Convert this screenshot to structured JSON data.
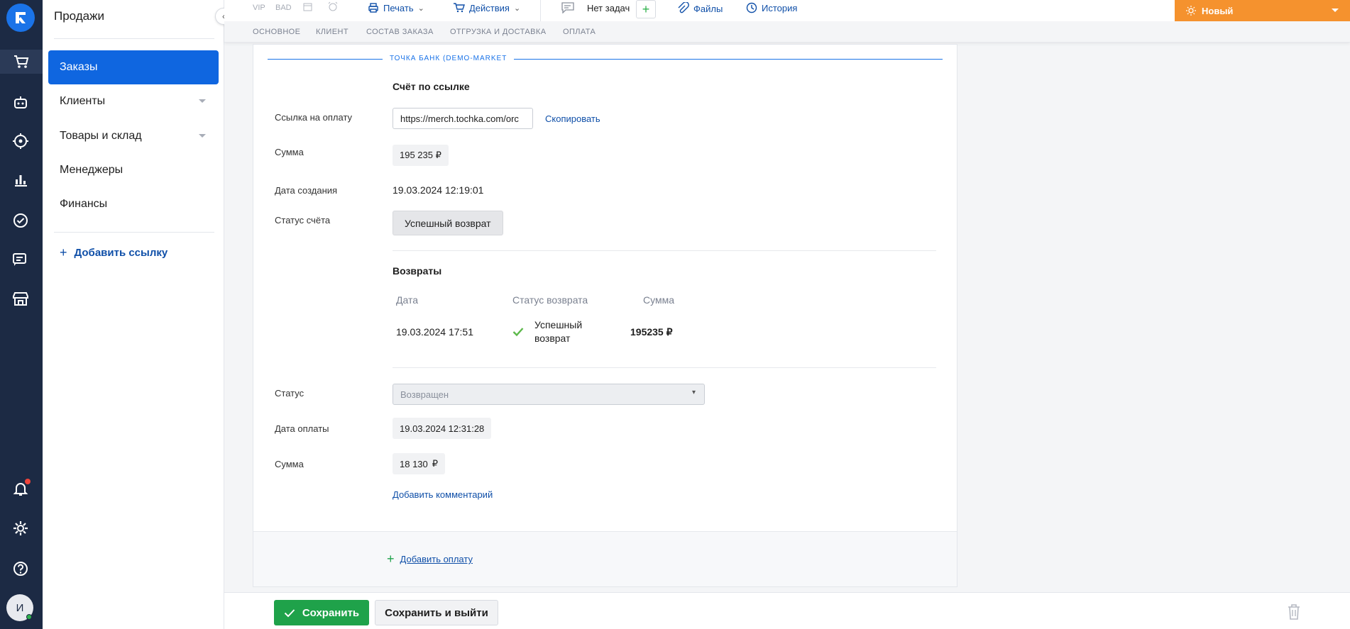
{
  "sidebar": {
    "title": "Продажи",
    "items": [
      {
        "label": "Заказы",
        "active": true
      },
      {
        "label": "Клиенты"
      },
      {
        "label": "Товары и склад"
      },
      {
        "label": "Менеджеры"
      },
      {
        "label": "Финансы"
      }
    ],
    "add_link": "Добавить ссылку"
  },
  "rail": {
    "avatar_initial": "И"
  },
  "topbar": {
    "vip": "VIP",
    "bad": "BAD",
    "print": "Печать",
    "actions": "Действия",
    "tasks": "Нет задач",
    "files": "Файлы",
    "history": "История",
    "status": "Новый",
    "status_color": "#f5922e"
  },
  "tabs": [
    "ОСНОВНОЕ",
    "КЛИЕНТ",
    "СОСТАВ ЗАКАЗА",
    "ОТГРУЗКА И ДОСТАВКА",
    "ОПЛАТА"
  ],
  "payment": {
    "bank": "ТОЧКА БАНК (DEMO-MARKET",
    "section_title": "Счёт по ссылке",
    "link_label": "Ссылка на оплату",
    "link_value": "https://merch.tochka.com/orc",
    "copy": "Скопировать",
    "sum_label": "Сумма",
    "sum_value": "195 235 ₽",
    "created_label": "Дата создания",
    "created_value": "19.03.2024 12:19:01",
    "invoice_status_label": "Статус счёта",
    "invoice_status_value": "Успешный возврат",
    "refunds": {
      "title": "Возвраты",
      "col_date": "Дата",
      "col_status": "Статус возврата",
      "col_sum": "Сумма",
      "rows": [
        {
          "date": "19.03.2024 17:51",
          "status_line1": "Успешный",
          "status_line2": "возврат",
          "sum": "195235 ₽"
        }
      ]
    },
    "status_label": "Статус",
    "status_value": "Возвращен",
    "paid_date_label": "Дата оплаты",
    "paid_date_value": "19.03.2024 12:31:28",
    "sum2_label": "Сумма",
    "sum2_value": "18 130",
    "sum2_currency": "₽",
    "add_comment": "Добавить комментарий",
    "add_payment": "Добавить оплату"
  },
  "bottom": {
    "save": "Сохранить",
    "save_exit": "Сохранить и выйти"
  }
}
